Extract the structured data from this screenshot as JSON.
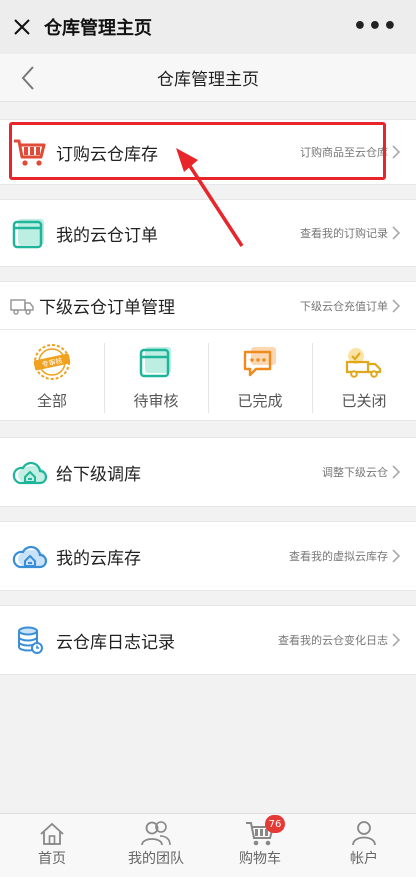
{
  "wechat_bar": {
    "title": "仓库管理主页",
    "more": "•••"
  },
  "nav": {
    "title": "仓库管理主页"
  },
  "rows": {
    "purchase": {
      "label": "订购云仓库存",
      "hint": "订购商品至云仓库",
      "icon": "shopping-cart-icon"
    },
    "my_orders": {
      "label": "我的云仓订单",
      "hint": "查看我的订购记录",
      "icon": "window-icon"
    },
    "sub_orders": {
      "label": "下级云仓订单管理",
      "hint": "下级云仓充值订单",
      "icon": "delivery-truck-icon"
    },
    "transfer": {
      "label": "给下级调库",
      "hint": "调整下级云仓",
      "icon": "cloud-warehouse-icon"
    },
    "my_stock": {
      "label": "我的云库存",
      "hint": "查看我的虚拟云库存",
      "icon": "cloud-warehouse-icon"
    },
    "logs": {
      "label": "云仓库日志记录",
      "hint": "查看我的云仓变化日志",
      "icon": "database-icon"
    }
  },
  "order_status": [
    {
      "label": "全部",
      "icon": "stamp-icon"
    },
    {
      "label": "待审核",
      "icon": "calendar-window-icon"
    },
    {
      "label": "已完成",
      "icon": "chat-bubble-icon"
    },
    {
      "label": "已关闭",
      "icon": "truck-check-icon"
    }
  ],
  "stamp_text": "专审核",
  "tabbar": {
    "items": [
      {
        "label": "首页",
        "icon": "home-icon"
      },
      {
        "label": "我的团队",
        "icon": "team-icon"
      },
      {
        "label": "购物车",
        "icon": "cart-icon",
        "badge": "76"
      },
      {
        "label": "帐户",
        "icon": "user-icon"
      }
    ]
  },
  "colors": {
    "accent_red": "#e6262b",
    "teal": "#1fb59a",
    "orange": "#f0a21e",
    "blue": "#3a8ed8"
  }
}
